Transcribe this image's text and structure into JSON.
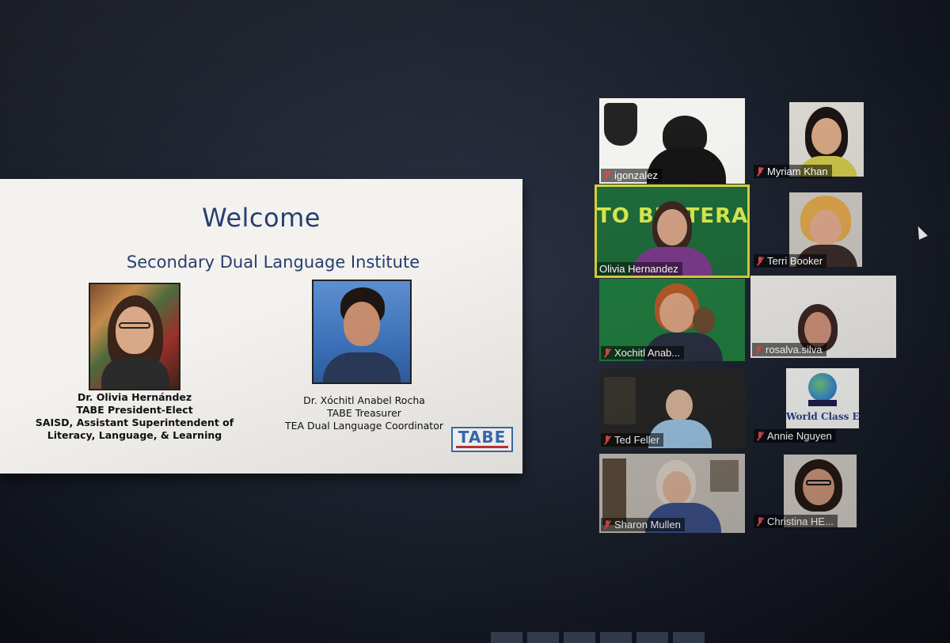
{
  "slide": {
    "title": "Welcome",
    "subtitle": "Secondary Dual Language Institute",
    "speaker1": {
      "name": "Dr. Olivia Hernández",
      "role": "TABE President-Elect",
      "line3": "SAISD, Assistant Superintendent of",
      "line4": "Literacy, Language, & Learning"
    },
    "speaker2": {
      "name": "Dr. Xóchitl Anabel Rocha",
      "role": "TABE Treasurer",
      "line3": "TEA Dual Language Coordinator"
    },
    "logo_text": "TABE"
  },
  "participants": [
    {
      "name": "igonzalez",
      "muted": true
    },
    {
      "name": "Myriam Khan",
      "muted": true
    },
    {
      "name": "Olivia Hernandez",
      "muted": false,
      "active_speaker": true
    },
    {
      "name": "Terri Booker",
      "muted": true
    },
    {
      "name": "Xochitl Anab...",
      "muted": true
    },
    {
      "name": "rosalva.silva",
      "muted": true
    },
    {
      "name": "Ted Feller",
      "muted": true
    },
    {
      "name": "Annie Nguyen",
      "muted": true
    },
    {
      "name": "Sharon Mullen",
      "muted": true
    },
    {
      "name": "Christina HE...",
      "muted": true
    }
  ],
  "tile_texts": {
    "bilitracy_banner": "TO BILITERACY",
    "world_class": "World Class ED"
  },
  "colors": {
    "slide_text": "#243d6e",
    "active_border": "#d7d23a",
    "mute_red": "#e04646"
  }
}
